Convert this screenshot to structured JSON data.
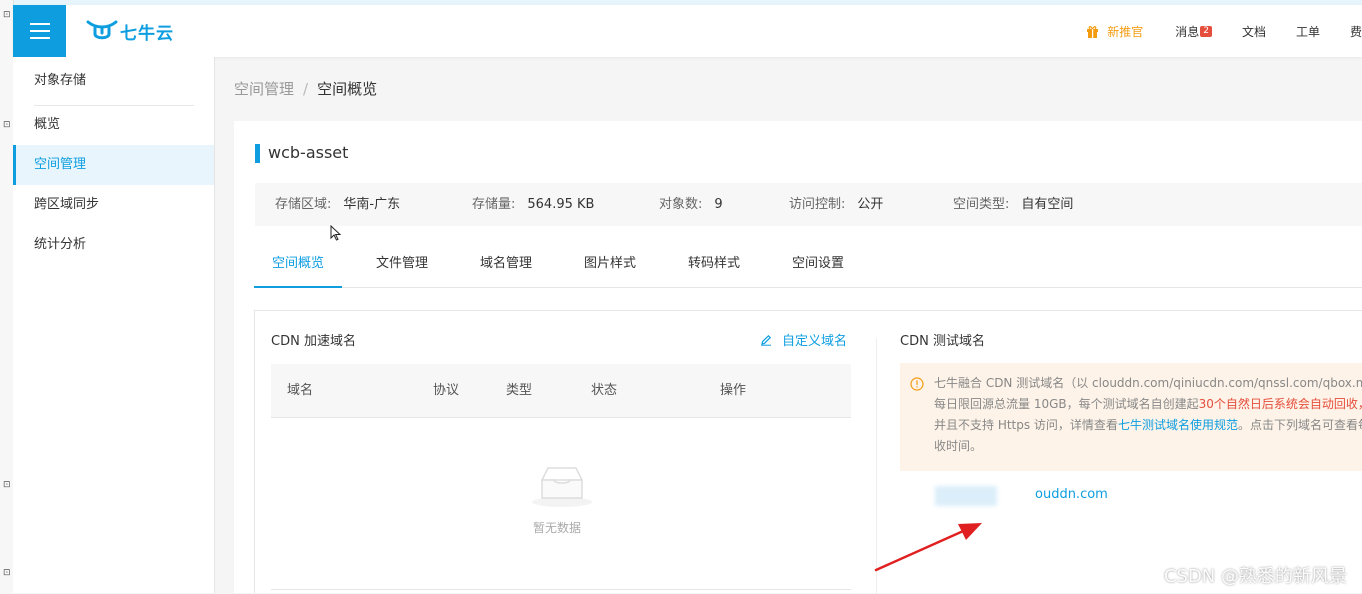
{
  "topbar": {
    "brand": "七牛云",
    "nav": {
      "recommend": "新推官",
      "messages": "消息",
      "message_count": "2",
      "docs": "文档",
      "tickets": "工单",
      "fees": "费"
    }
  },
  "sidebar": {
    "items": [
      {
        "label": "对象存储"
      },
      {
        "label": "概览"
      },
      {
        "label": "空间管理"
      },
      {
        "label": "跨区域同步"
      },
      {
        "label": "统计分析"
      }
    ]
  },
  "breadcrumb": {
    "parent": "空间管理",
    "separator": "/",
    "current": "空间概览"
  },
  "bucket": {
    "name": "wcb-asset",
    "region_label": "存储区域:",
    "region_value": "华南-广东",
    "storage_label": "存储量:",
    "storage_value": "564.95 KB",
    "objects_label": "对象数:",
    "objects_value": "9",
    "access_label": "访问控制:",
    "access_value": "公开",
    "type_label": "空间类型:",
    "type_value": "自有空间"
  },
  "tabs": [
    {
      "label": "空间概览"
    },
    {
      "label": "文件管理"
    },
    {
      "label": "域名管理"
    },
    {
      "label": "图片样式"
    },
    {
      "label": "转码样式"
    },
    {
      "label": "空间设置"
    }
  ],
  "cdn": {
    "title": "CDN 加速域名",
    "custom_domain": "自定义域名",
    "columns": [
      "域名",
      "协议",
      "类型",
      "状态",
      "操作"
    ],
    "empty": "暂无数据"
  },
  "test_domain": {
    "title": "CDN 测试域名",
    "notice_line1": "七牛融合 CDN 测试域名（以 clouddn.com/qiniucdn.com/qnssl.com/qbox.me 结尾",
    "notice_line2_a": "每日限回源总流量 10GB，每个测试域名自创建起",
    "notice_line2_b": "30个自然日后系统会自动回收，",
    "notice_line3_a": "并且不支持 Https 访问，详情查看",
    "notice_line3_b": "七牛测试域名使用规范",
    "notice_line3_c": "。点击下列域名可查看每",
    "notice_line4": "收时间。",
    "domain_suffix": "ouddn.com"
  },
  "watermark": "CSDN @熟悉的新风景",
  "colors": {
    "brand": "#0e9ee0",
    "warning": "#f39c12",
    "danger": "#e54e3c",
    "notice_bg": "#fdf3e8"
  }
}
